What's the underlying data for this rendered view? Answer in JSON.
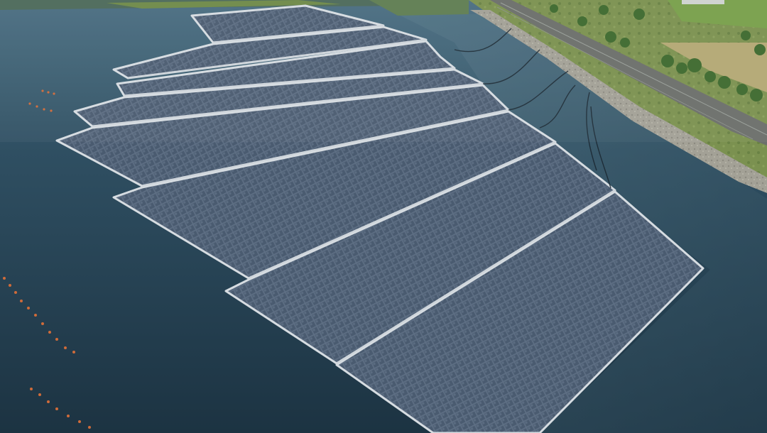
{
  "scene": {
    "subject": "floating-solar-farm",
    "palette": {
      "water_light": "#4a6e80",
      "water_mid": "#2e4d5e",
      "water_dark": "#1b3140",
      "panel": "#5e6f84",
      "panel_dark": "#47586d",
      "frame": "#d7dde2",
      "grass": "#6f8f4a",
      "tree": "#3f6b2f",
      "road": "#6b6e6a",
      "bank": "#9c9a8f",
      "buoy": "#d26a3a"
    }
  }
}
